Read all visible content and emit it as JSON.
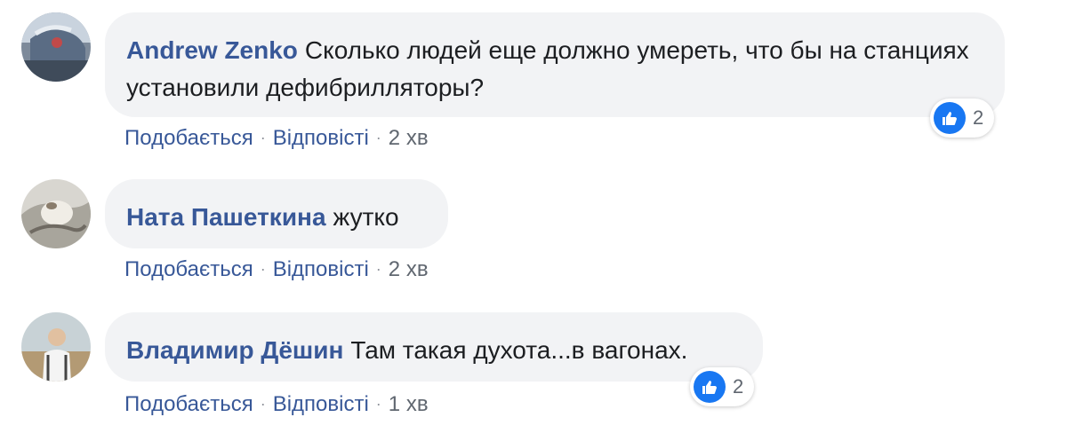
{
  "comments": [
    {
      "author": "Andrew Zenko",
      "text": "Сколько людей еще должно умереть, что бы на станциях установили дефибрилляторы?",
      "actions": {
        "like": "Подобається",
        "reply": "Відповісті",
        "time": "2 хв"
      },
      "reaction": {
        "icon": "like-icon",
        "count": "2"
      }
    },
    {
      "author": "Ната Пашеткина",
      "text": "жутко",
      "actions": {
        "like": "Подобається",
        "reply": "Відповісті",
        "time": "2 хв"
      }
    },
    {
      "author": "Владимир Дёшин",
      "text": "Там такая духота...в вагонах.",
      "actions": {
        "like": "Подобається",
        "reply": "Відповісті",
        "time": "1 хв"
      },
      "reaction": {
        "icon": "like-icon",
        "count": "2"
      }
    }
  ],
  "colors": {
    "author": "#385898",
    "bubble": "#f2f3f5",
    "meta": "#606770",
    "like": "#1877f2"
  }
}
